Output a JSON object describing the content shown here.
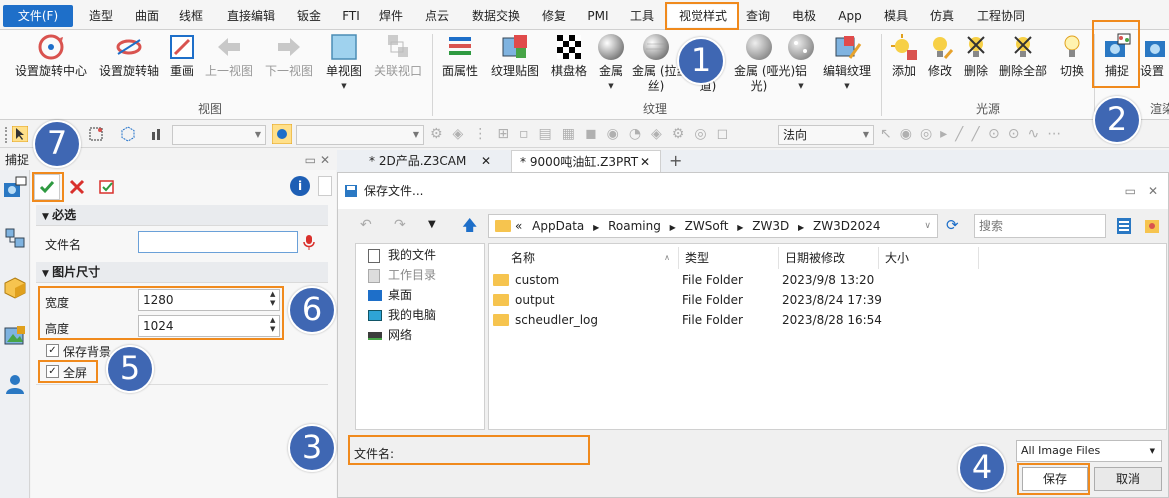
{
  "menubar": {
    "items": [
      "文件(F)",
      "造型",
      "曲面",
      "线框",
      "直接编辑",
      "钣金",
      "FTI",
      "焊件",
      "点云",
      "数据交换",
      "修复",
      "PMI",
      "工具",
      "视觉样式",
      "查询",
      "电极",
      "App",
      "模具",
      "仿真",
      "工程协同"
    ],
    "active": "视觉样式"
  },
  "ribbon": {
    "view_group": {
      "label": "视图",
      "buttons": [
        "设置旋转中心",
        "设置旋转轴",
        "重画",
        "上一视图",
        "下一视图",
        "单视图",
        "关联视口"
      ]
    },
    "texture_group": {
      "label": "纹理",
      "buttons": [
        "面属性",
        "纹理贴图",
        "棋盘格",
        "金属",
        "金属 (拉丝)",
        "金属 (哑光)",
        "铝",
        "编辑纹理"
      ],
      "partial_lines": [
        "丝)",
        "光)",
        "道)"
      ]
    },
    "light_group": {
      "label": "光源",
      "buttons": [
        "添加",
        "修改",
        "删除",
        "删除全部",
        "切换"
      ]
    },
    "capture_group": {
      "label": "渲染",
      "buttons": [
        "捕捉",
        "设置"
      ]
    }
  },
  "toolbar": {
    "combo_normal": "法向"
  },
  "left_panel": {
    "title": "捕捉",
    "required_section": "必选",
    "filename_label": "文件名",
    "filename_value": "",
    "size_section": "图片尺寸",
    "width_label": "宽度",
    "width_value": "1280",
    "height_label": "高度",
    "height_value": "1024",
    "keep_bg_label": "保存背景",
    "fullscreen_label": "全屏",
    "info_symbol": "i"
  },
  "tabs": [
    {
      "label": "* 2D产品.Z3CAM",
      "close": "✕"
    },
    {
      "label": "* 9000吨油缸.Z3PRT",
      "close": "✕"
    }
  ],
  "tab_add": "+",
  "dialog": {
    "title": "保存文件...",
    "path": [
      "«",
      "AppData",
      "Roaming",
      "ZWSoft",
      "ZW3D",
      "ZW3D2024"
    ],
    "search_placeholder": "搜索",
    "tree": [
      "我的文件",
      "工作目录",
      "桌面",
      "我的电脑",
      "网络"
    ],
    "columns": [
      "名称",
      "类型",
      "日期被修改",
      "大小"
    ],
    "rows": [
      {
        "name": "custom",
        "type": "File Folder",
        "date": "2023/9/8 13:20"
      },
      {
        "name": "output",
        "type": "File Folder",
        "date": "2023/8/24 17:39"
      },
      {
        "name": "scheudler_log",
        "type": "File Folder",
        "date": "2023/8/28 16:54"
      }
    ],
    "filename_label": "文件名:",
    "filename_value": "",
    "filetype": "All Image Files",
    "save_button": "保存",
    "cancel_button": "取消"
  },
  "callouts": [
    "1",
    "2",
    "3",
    "4",
    "5",
    "6",
    "7"
  ],
  "colors": {
    "accent": "#1e6fc9",
    "highlight": "#f08a1d",
    "callout": "#3f67b3"
  }
}
